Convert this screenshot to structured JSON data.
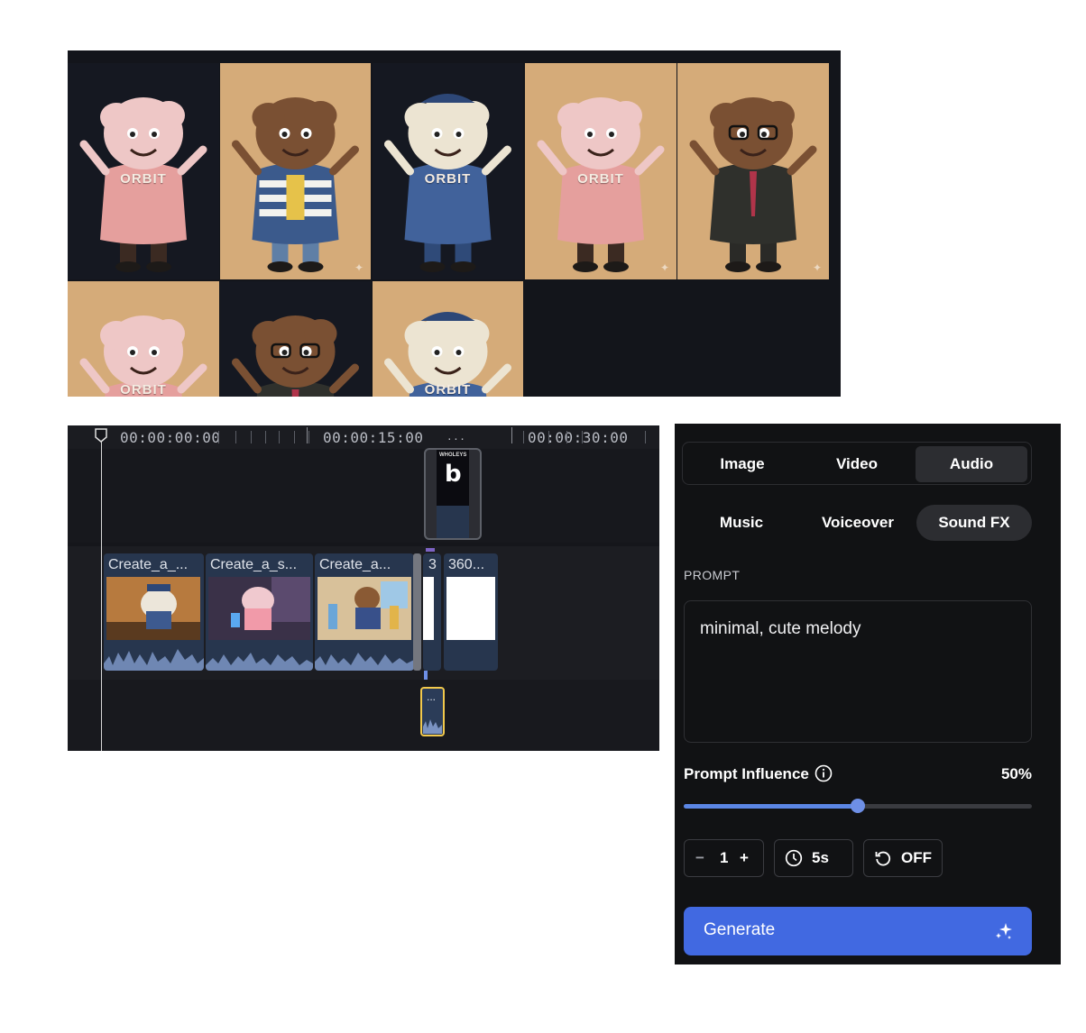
{
  "gallery": {
    "items": [
      {
        "character": "pink cloud girl",
        "shirt_text": "ORBIT",
        "background": "dark"
      },
      {
        "character": "curly hair kid",
        "shirt_text": "",
        "background": "tan"
      },
      {
        "character": "blue cloud boy",
        "shirt_text": "ORBIT",
        "background": "dark"
      },
      {
        "character": "pink cloud girl",
        "shirt_text": "ORBIT",
        "background": "tan"
      },
      {
        "character": "man in suit",
        "shirt_text": "",
        "background": "tan"
      },
      {
        "character": "pink cloud girl",
        "shirt_text": "ORBIT",
        "background": "tan"
      },
      {
        "character": "man in suit",
        "shirt_text": "",
        "background": "dark"
      },
      {
        "character": "blue cloud boy",
        "shirt_text": "ORBIT",
        "background": "tan"
      }
    ]
  },
  "timeline": {
    "timecodes": [
      "00:00:00:00",
      "00:00:15:00",
      "00:00:30:00"
    ],
    "ruler_dots": "...",
    "clips": [
      {
        "label": "Create_a_..."
      },
      {
        "label": "Create_a_s..."
      },
      {
        "label": "Create_a..."
      },
      {
        "label": "3"
      },
      {
        "label": "360..."
      }
    ],
    "video_clip_brand": "WHOLEYS",
    "sfx_dots": "..."
  },
  "panel": {
    "media_tabs": [
      "Image",
      "Video",
      "Audio"
    ],
    "media_active": "Audio",
    "audio_tabs": [
      "Music",
      "Voiceover",
      "Sound FX"
    ],
    "audio_active": "Sound FX",
    "prompt_label": "PROMPT",
    "prompt_value": "minimal, cute melody",
    "influence_label": "Prompt Influence",
    "influence_value_text": "50%",
    "influence_value": 0.5,
    "count_minus": "−",
    "count_value": "1",
    "count_plus": "+",
    "duration": "5s",
    "loop": "OFF",
    "generate_label": "Generate",
    "colors": {
      "accent": "#4169e1",
      "slider": "#5b86e5"
    }
  }
}
